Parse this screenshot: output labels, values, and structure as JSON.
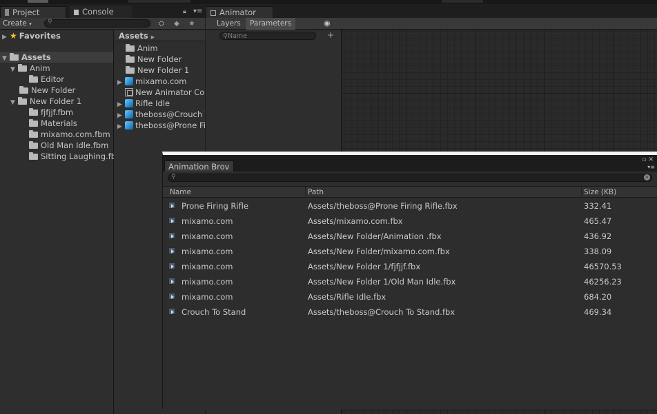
{
  "project_window": {
    "tab_project": "Project",
    "tab_console": "Console",
    "create_label": "Create",
    "tree": {
      "favorites": "Favorites",
      "assets": "Assets",
      "items": [
        "Anim",
        "Editor",
        "New Folder",
        "New Folder 1",
        "fjfjjf.fbm",
        "Materials",
        "mixamo.com.fbm",
        "Old Man Idle.fbm",
        "Sitting Laughing.fbm"
      ]
    },
    "files_header": "Assets",
    "files": [
      "Anim",
      "New Folder",
      "New Folder 1",
      "mixamo.com",
      "New Animator Controller",
      "Rifle Idle",
      "theboss@Crouch To Stand",
      "theboss@Prone Firing Rifle"
    ]
  },
  "animator": {
    "tab": "Animator",
    "layers_tab": "Layers",
    "parameters_tab": "Parameters",
    "param_search_placeholder": "Name"
  },
  "animation_browser": {
    "title": "Animation Brov",
    "columns": {
      "name": "Name",
      "path": "Path",
      "size": "Size (KB)"
    },
    "rows": [
      {
        "name": "Prone Firing Rifle",
        "path": "Assets/theboss@Prone Firing Rifle.fbx",
        "size": "332.41"
      },
      {
        "name": "mixamo.com",
        "path": "Assets/mixamo.com.fbx",
        "size": "465.47"
      },
      {
        "name": "mixamo.com",
        "path": "Assets/New Folder/Animation .fbx",
        "size": "436.92"
      },
      {
        "name": "mixamo.com",
        "path": "Assets/New Folder/mixamo.com.fbx",
        "size": "338.09"
      },
      {
        "name": "mixamo.com",
        "path": "Assets/New Folder 1/fjfjjf.fbx",
        "size": "46570.53"
      },
      {
        "name": "mixamo.com",
        "path": "Assets/New Folder 1/Old Man Idle.fbx",
        "size": "46256.23"
      },
      {
        "name": "mixamo.com",
        "path": "Assets/Rifle Idle.fbx",
        "size": "684.20"
      },
      {
        "name": "Crouch To Stand",
        "path": "Assets/theboss@Crouch To Stand.fbx",
        "size": "469.34"
      }
    ]
  },
  "icons": [
    "folder-icon",
    "star-icon",
    "model-icon",
    "animator-controller-icon",
    "animation-clip-icon",
    "search-icon",
    "lock-icon",
    "menu-icon",
    "eye-icon",
    "plus-icon",
    "maximize-icon",
    "close-icon",
    "clear-icon"
  ]
}
